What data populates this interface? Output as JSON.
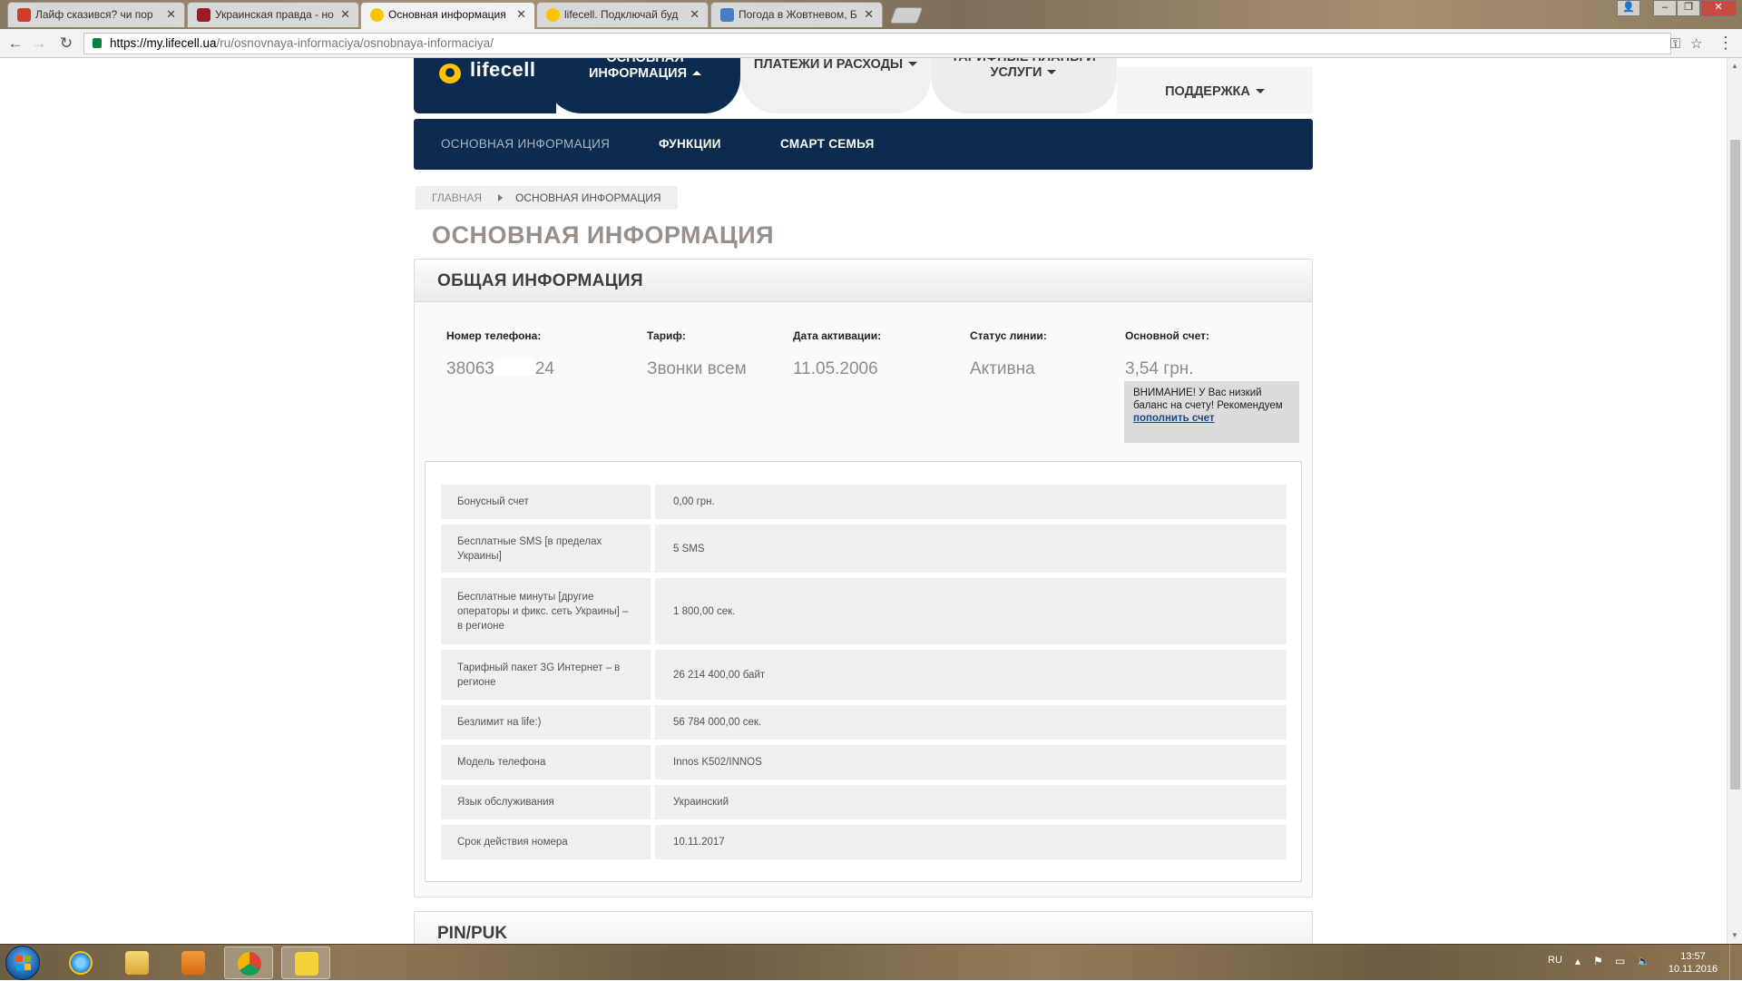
{
  "browser": {
    "tabs": [
      {
        "title": "Лайф сказився? чи пор",
        "favicon_color": "#d23a2a"
      },
      {
        "title": "Украинская правда - но",
        "favicon_color": "#9c1b26"
      },
      {
        "title": "Основная информация",
        "favicon_color": "#ffc400"
      },
      {
        "title": "lifecell. Подключай буд",
        "favicon_color": "#ffc400"
      },
      {
        "title": "Погода в Жовтневом, Б",
        "favicon_color": "#4a7ac0"
      }
    ],
    "url_host": "https://my.lifecell.ua",
    "url_path": "/ru/osnovnaya-informaciya/osnobnaya-informaciya/"
  },
  "site": {
    "logo_text": "lifecell",
    "nav": {
      "basic": "ОСНОВНАЯ ИНФОРМАЦИЯ",
      "payments": "ПЛАТЕЖИ И РАСХОДЫ",
      "tariffs": "ТАРИФНЫЕ ПЛАНЫ И УСЛУГИ",
      "support": "ПОДДЕРЖКА"
    },
    "subnav": [
      "ОСНОВНАЯ ИНФОРМАЦИЯ",
      "ФУНКЦИИ",
      "СМАРТ СЕМЬЯ"
    ],
    "breadcrumb": {
      "home": "ГЛАВНАЯ",
      "current": "ОСНОВНАЯ ИНФОРМАЦИЯ"
    },
    "page_title": "ОСНОВНАЯ ИНФОРМАЦИЯ",
    "accent_color": "#0c2b4e",
    "brand_yellow": "#ffc400"
  },
  "general": {
    "heading": "ОБЩАЯ ИНФОРМАЦИЯ",
    "phone_label": "Номер телефона:",
    "phone_prefix": "38063",
    "phone_suffix": "24",
    "tariff_label": "Тариф:",
    "tariff_value": "Звонки всем",
    "activation_label": "Дата активации:",
    "activation_value": "11.05.2006",
    "status_label": "Статус линии:",
    "status_value": "Активна",
    "balance_label": "Основной счет:",
    "balance_value": "3,54 грн.",
    "warning_text": "ВНИМАНИЕ! У Вас низкий баланс на счету! Рекомендуем ",
    "warning_link": "пополнить счет"
  },
  "details": [
    {
      "key": "Бонусный счет",
      "value": "0,00 грн."
    },
    {
      "key": "Бесплатные SMS [в пределах Украины]",
      "value": "5 SMS"
    },
    {
      "key": "Бесплатные минуты [другие операторы и фикс. сеть Украины] – в регионе",
      "value": "1 800,00 сек."
    },
    {
      "key": "Тарифный пакет 3G Интернет – в регионе",
      "value": "26 214 400,00 байт"
    },
    {
      "key": "Безлимит на life:)",
      "value": "56 784 000,00 сек."
    },
    {
      "key": "Модель телефона",
      "value": "Innos K502/INNOS"
    },
    {
      "key": "Язык обслуживания",
      "value": "Украинский"
    },
    {
      "key": "Срок действия номера",
      "value": "10.11.2017"
    }
  ],
  "pin_heading": "PIN/PUK",
  "taskbar": {
    "lang": "RU",
    "time": "13:57",
    "date": "10.11.2016"
  }
}
